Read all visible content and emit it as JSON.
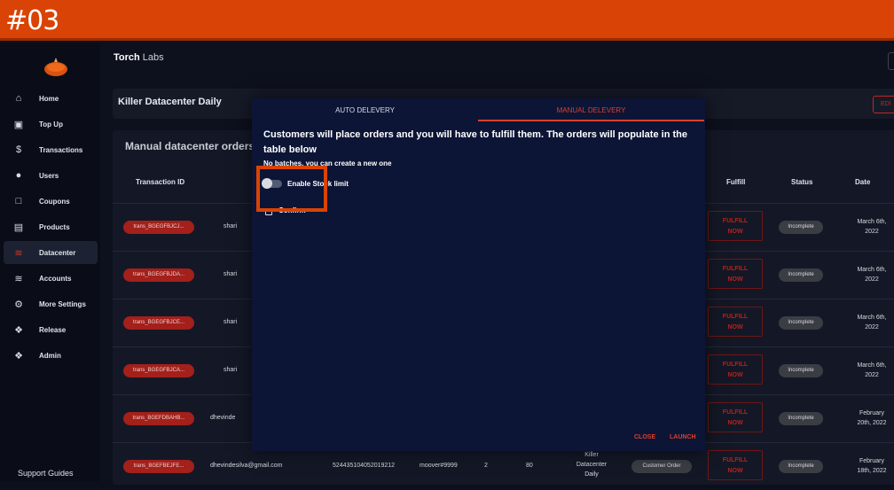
{
  "banner": {
    "label": "#03"
  },
  "header": {
    "org_bold": "Torch",
    "org_rest": " Labs"
  },
  "sidebar": {
    "items": [
      {
        "label": "Home",
        "icon": "home-icon"
      },
      {
        "label": "Top Up",
        "icon": "wallet-icon"
      },
      {
        "label": "Transactions",
        "icon": "dollar-icon"
      },
      {
        "label": "Users",
        "icon": "user-icon"
      },
      {
        "label": "Coupons",
        "icon": "coupon-icon"
      },
      {
        "label": "Products",
        "icon": "products-icon"
      },
      {
        "label": "Datacenter",
        "icon": "wifi-icon",
        "active": true
      },
      {
        "label": "Accounts",
        "icon": "wifi-icon"
      },
      {
        "label": "More Settings",
        "icon": "gear-icon"
      },
      {
        "label": "Release",
        "icon": "badge-icon"
      },
      {
        "label": "Admin",
        "icon": "badge-icon"
      }
    ],
    "support": "Support Guides"
  },
  "product_card": {
    "title": "Killer Datacenter Daily",
    "edit": "EDI"
  },
  "orders_card": {
    "title": "Manual datacenter orders t",
    "headers": {
      "txn": "Transaction ID",
      "fulfill": "Fulfill",
      "status": "Status",
      "date": "Date"
    },
    "rows": [
      {
        "txn": "trans_BGEGFBJCJ...",
        "user": "shari",
        "fulfill": [
          "FULFILL",
          "NOW"
        ],
        "status": "Incomplete",
        "date": [
          "March 6th,",
          "2022"
        ]
      },
      {
        "txn": "trans_BGEGFBJDA...",
        "user": "shari",
        "fulfill": [
          "FULFILL",
          "NOW"
        ],
        "status": "Incomplete",
        "date": [
          "March 6th,",
          "2022"
        ]
      },
      {
        "txn": "trans_BGEGFBJCE...",
        "user": "shari",
        "fulfill": [
          "FULFILL",
          "NOW"
        ],
        "status": "Incomplete",
        "date": [
          "March 6th,",
          "2022"
        ]
      },
      {
        "txn": "trans_BGEGFBJCA...",
        "user": "shari",
        "fulfill": [
          "FULFILL",
          "NOW"
        ],
        "status": "Incomplete",
        "date": [
          "March 6th,",
          "2022"
        ]
      },
      {
        "txn": "trans_BGEFDBAHB...",
        "user": "dhevinde",
        "fulfill": [
          "FULFILL",
          "NOW"
        ],
        "status": "Incomplete",
        "date": [
          "February",
          "20th, 2022"
        ]
      },
      {
        "txn": "trans_BGEFBEJFE...",
        "user": "dhevindesilva@gmail.com",
        "discord_id": "524435104052019212",
        "discord": "moover#9999",
        "qty": "2",
        "amount": "80",
        "product": [
          "Killer",
          "Datacenter",
          "Daily"
        ],
        "type": "Customer Order",
        "fulfill": [
          "FULFILL",
          "NOW"
        ],
        "status": "Incomplete",
        "date": [
          "February",
          "18th, 2022"
        ]
      }
    ]
  },
  "modal": {
    "tabs": {
      "auto": "AUTO DELEVERY",
      "manual": "MANUAL DELEVERY"
    },
    "heading": "Customers will place orders and you will have to fulfill them. The orders will populate in the table below",
    "subtext": "No batches, you can create a new one",
    "toggle_label": "Enable Stock limit",
    "confirm_label": "Confirm",
    "close": "CLOSE",
    "launch": "LAUNCH"
  },
  "colors": {
    "accent": "#d8402f",
    "banner": "#d94305",
    "modal_bg": "#0d1536"
  }
}
